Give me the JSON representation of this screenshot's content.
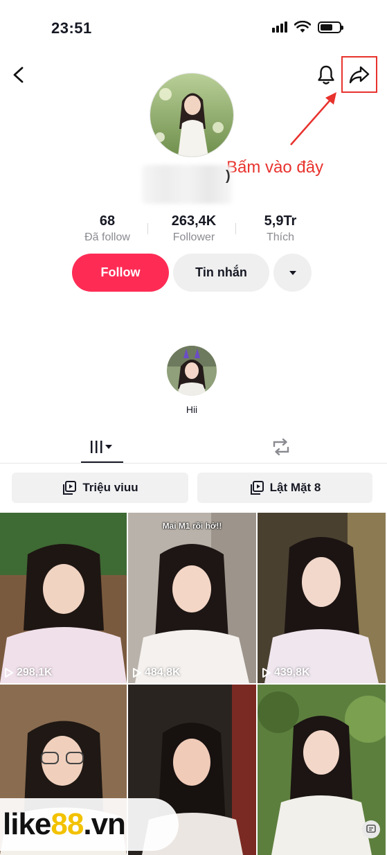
{
  "status_bar": {
    "time": "23:51"
  },
  "annotation": {
    "text": "Bấm vào đây",
    "color": "#e8322d"
  },
  "profile": {
    "name_tail": ")",
    "stats": [
      {
        "value": "68",
        "label": "Đã follow"
      },
      {
        "value": "263,4K",
        "label": "Follower"
      },
      {
        "value": "5,9Tr",
        "label": "Thích"
      }
    ],
    "follow_label": "Follow",
    "message_label": "Tin nhắn",
    "story_label": "Hii"
  },
  "playlists": [
    {
      "label": "Triệu viuu"
    },
    {
      "label": "Lật Mặt 8"
    }
  ],
  "videos": [
    {
      "views": "298,1K",
      "caption": ""
    },
    {
      "views": "484,8K",
      "caption": "Mai M1 rồi hở!!"
    },
    {
      "views": "439,8K",
      "caption": ""
    },
    {
      "views": "",
      "caption": ""
    },
    {
      "views": "",
      "caption": ""
    },
    {
      "views": "",
      "caption": ""
    }
  ],
  "watermark": {
    "part1": "like",
    "part2": "88",
    "part3": ".vn"
  },
  "colors": {
    "accent": "#fe2c55",
    "annotation": "#e8322d",
    "watermark_yellow": "#f2c200"
  }
}
